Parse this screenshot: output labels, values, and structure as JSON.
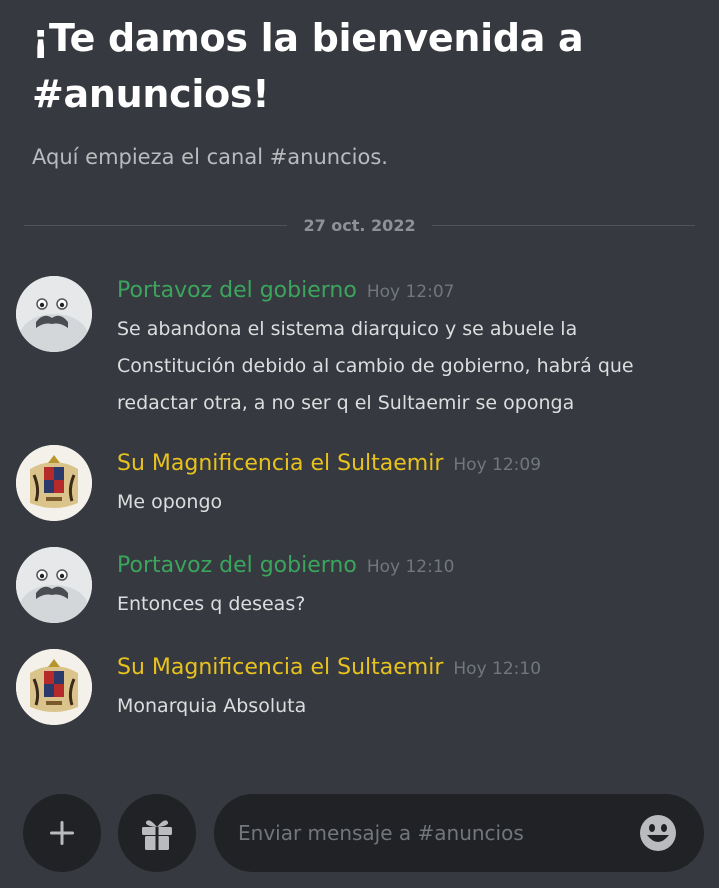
{
  "channel": {
    "welcome_title": "¡Te damos la bienvenida a #anuncios!",
    "welcome_subtitle": "Aquí empieza el canal #anuncios."
  },
  "date_divider": "27 oct. 2022",
  "colors": {
    "background": "#36393f",
    "author_green": "#3ba55d",
    "author_gold": "#e8c21e",
    "composer_bg": "#202225"
  },
  "messages": [
    {
      "author": "Portavoz del gobierno",
      "time": "Hoy 12:07",
      "text": "Se abandona el sistema diarquico y se abuele la Constitución debido al cambio de gobierno, habrá que redactar otra, a no ser q el Sultaemir se oponga",
      "avatar": "seal-avatar-icon"
    },
    {
      "author": "Su Magnificencia el Sultaemir",
      "time": "Hoy 12:09",
      "text": "Me opongo",
      "avatar": "coat-of-arms-avatar-icon"
    },
    {
      "author": "Portavoz del gobierno",
      "time": "Hoy 12:10",
      "text": "Entonces q deseas?",
      "avatar": "seal-avatar-icon"
    },
    {
      "author": "Su Magnificencia el Sultaemir",
      "time": "Hoy 12:10",
      "text": "Monarquia Absoluta",
      "avatar": "coat-of-arms-avatar-icon"
    }
  ],
  "composer": {
    "placeholder": "Enviar mensaje a #anuncios",
    "add_icon": "plus-icon",
    "gift_icon": "gift-icon",
    "emoji_icon": "emoji-icon"
  }
}
